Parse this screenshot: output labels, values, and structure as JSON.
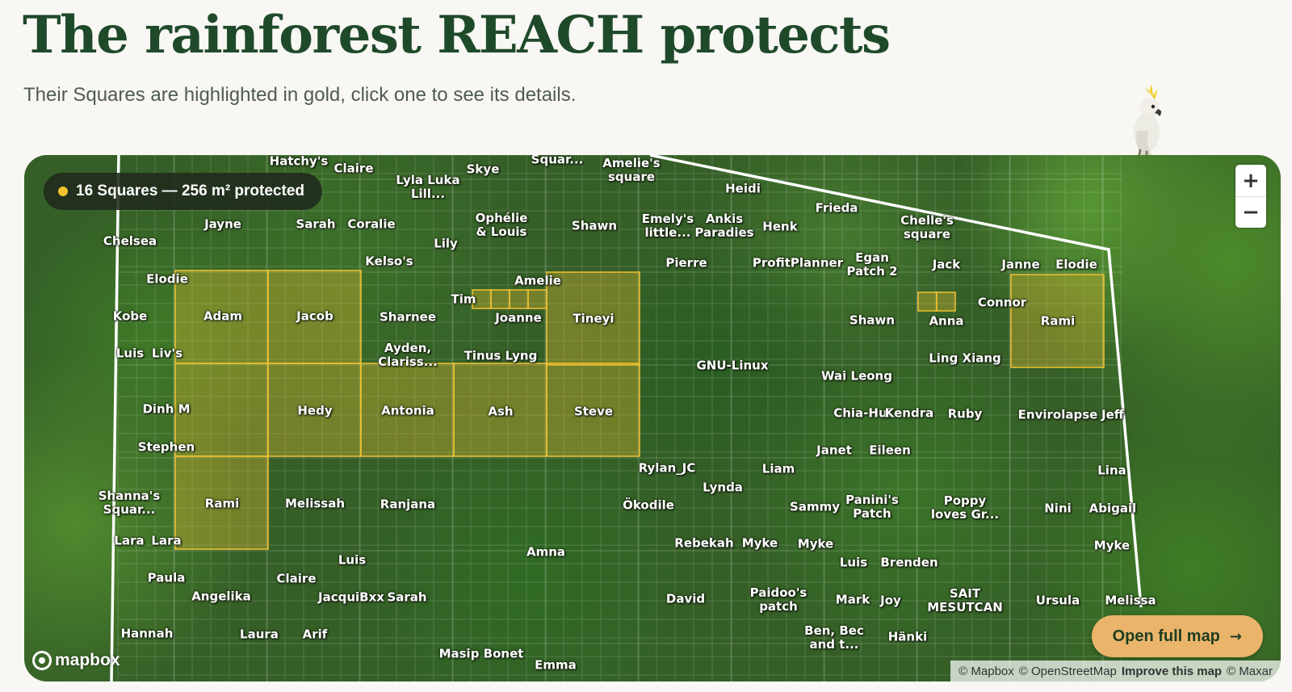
{
  "header": {
    "title": "The rainforest REACH protects",
    "subtitle": "Their Squares are highlighted in gold, click one to see its details."
  },
  "mascot": {
    "icon": "cockatoo-icon"
  },
  "map": {
    "summary": "16 Squares — 256 m² protected",
    "zoom_in": "+",
    "zoom_out": "−",
    "logo": "mapbox",
    "attribution": {
      "mapbox": "© Mapbox",
      "osm": "© OpenStreetMap",
      "improve": "Improve this map",
      "maxar": "© Maxar"
    },
    "open_button": "Open full map",
    "open_button_icon": "arrow-right-icon",
    "highlight_color": "#f2c230",
    "boundary_color": "#ffffff",
    "highlighted_labels": [
      "Adam",
      "Jacob",
      "Tineyi",
      "Rami",
      "Hedy",
      "Antonia",
      "Ash",
      "Steve",
      "Rami",
      "Tim"
    ],
    "labels": [
      "Hatchy's",
      "Claire",
      "Lyla Luka\nLill...",
      "Skye",
      "Squar...",
      "Amelie's\nsquare",
      "Heidi",
      "Jayne",
      "Sarah",
      "Coralie",
      "Ophélie\n& Louis",
      "Shawn",
      "Emely's\nlittle...",
      "Ankis\nParadies",
      "Henk",
      "Frieda",
      "Chelle's\nsquare",
      "Chelsea",
      "Lily",
      "Kelso's",
      "Pierre",
      "ProfitPlanner",
      "Egan\nPatch 2",
      "Jack",
      "Janne",
      "Elodie",
      "Elodie",
      "Amelie",
      "Tim",
      "Connor",
      "Kobe",
      "Adam",
      "Jacob",
      "Sharnee",
      "Joanne",
      "Tineyi",
      "Shawn",
      "Anna",
      "Rami",
      "Luis",
      "Liv's",
      "Ayden,\nClariss...",
      "Tinus Lyng",
      "GNU-Linux",
      "Ling Xiang",
      "Wai Leong",
      "Dinh M",
      "Hedy",
      "Antonia",
      "Ash",
      "Steve",
      "Chia-Hui",
      "Kendra",
      "Ruby",
      "Envirolapse",
      "Jeff",
      "Stephen",
      "Janet",
      "Eileen",
      "Rylan_JC",
      "Liam",
      "Lina",
      "Lynda",
      "Shanna's\nSquar...",
      "Rami",
      "Melissah",
      "Ranjana",
      "Ökodile",
      "Sammy",
      "Panini's\nPatch",
      "Poppy\nloves Gr...",
      "Nini",
      "Abigail",
      "Lara",
      "Lara",
      "Rebekah",
      "Myke",
      "Myke",
      "Myke",
      "Amna",
      "Luis",
      "Luis",
      "Brenden",
      "Paula",
      "Claire",
      "Angelika",
      "JacquiBxx",
      "Sarah",
      "David",
      "Paidoo's\npatch",
      "Mark",
      "Joy",
      "SAIT\nMESUTCAN",
      "Ursula",
      "Melissa",
      "Hannah",
      "Laura",
      "Arif",
      "Ben, Bec\nand t...",
      "Hänki",
      "Masip Bonet",
      "Emma"
    ]
  }
}
